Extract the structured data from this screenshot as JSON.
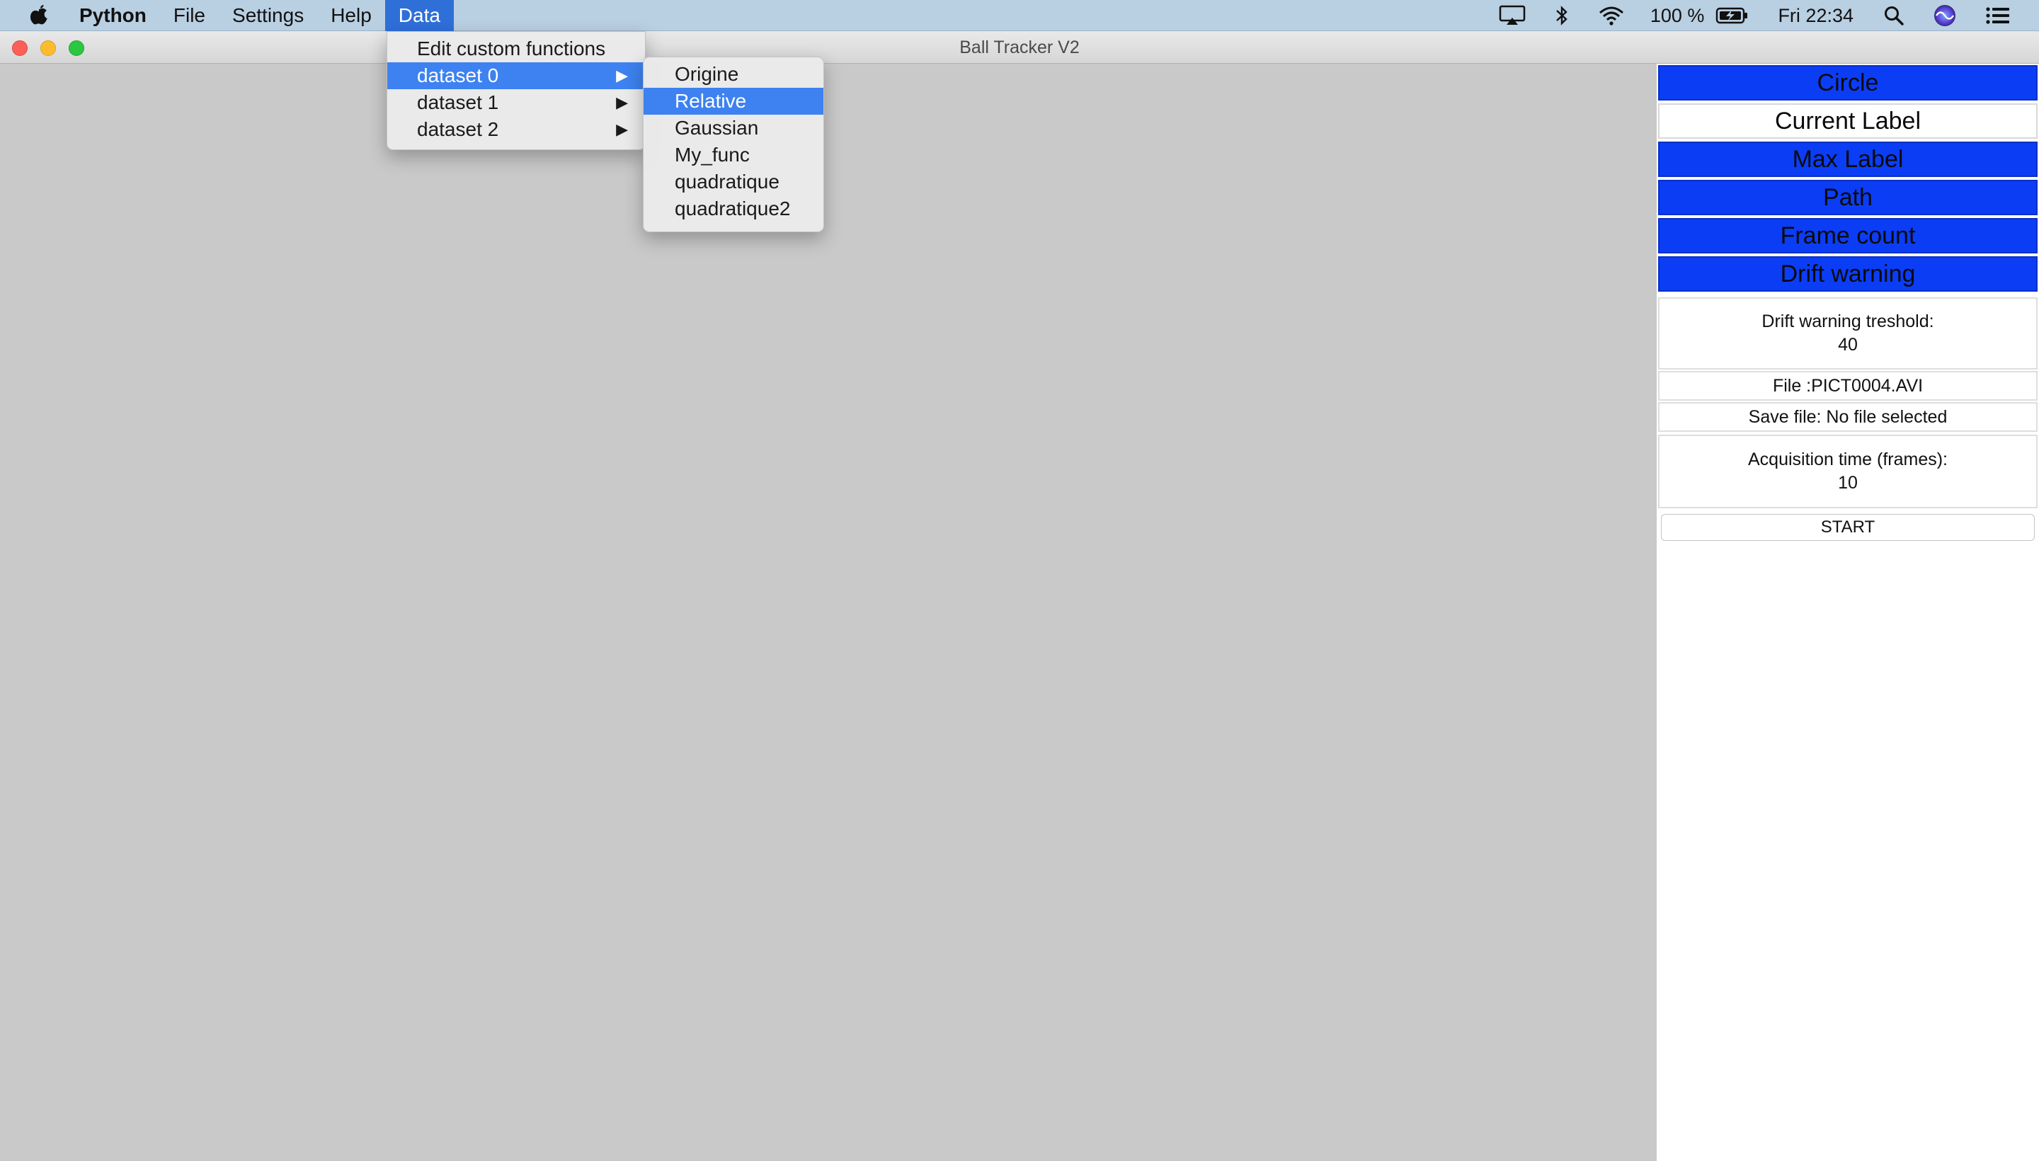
{
  "menubar": {
    "app_name": "Python",
    "menus": [
      "File",
      "Settings",
      "Help",
      "Data"
    ],
    "battery": "100 %",
    "clock": "Fri 22:34"
  },
  "window": {
    "title": "Ball Tracker V2"
  },
  "data_menu": {
    "items": [
      {
        "label": "Edit custom functions"
      },
      {
        "label": "dataset 0",
        "arrow": "▶"
      },
      {
        "label": "dataset 1",
        "arrow": "▶"
      },
      {
        "label": "dataset 2",
        "arrow": "▶"
      }
    ]
  },
  "dataset_submenu": {
    "items": [
      "Origine",
      "Relative",
      "Gaussian",
      "My_func",
      "quadratique",
      "quadratique2"
    ],
    "highlighted": "Relative"
  },
  "panel": {
    "toggles": [
      {
        "label": "Circle",
        "state": "on"
      },
      {
        "label": "Current Label",
        "state": "off"
      },
      {
        "label": "Max Label",
        "state": "on"
      },
      {
        "label": "Path",
        "state": "on"
      },
      {
        "label": "Frame count",
        "state": "on"
      },
      {
        "label": "Drift warning",
        "state": "on"
      }
    ],
    "drift_label": "Drift warning treshold:",
    "drift_value": "40",
    "file_label": "File :PICT0004.AVI",
    "save_label": "Save file: No file selected",
    "acq_label": "Acquisition time (frames):",
    "acq_value": "10",
    "start_label": "START"
  },
  "colors": {
    "toggle_on": "#0b3df5",
    "menu_highlight": "#3d82f0",
    "menubar": "#b9cfe2"
  }
}
